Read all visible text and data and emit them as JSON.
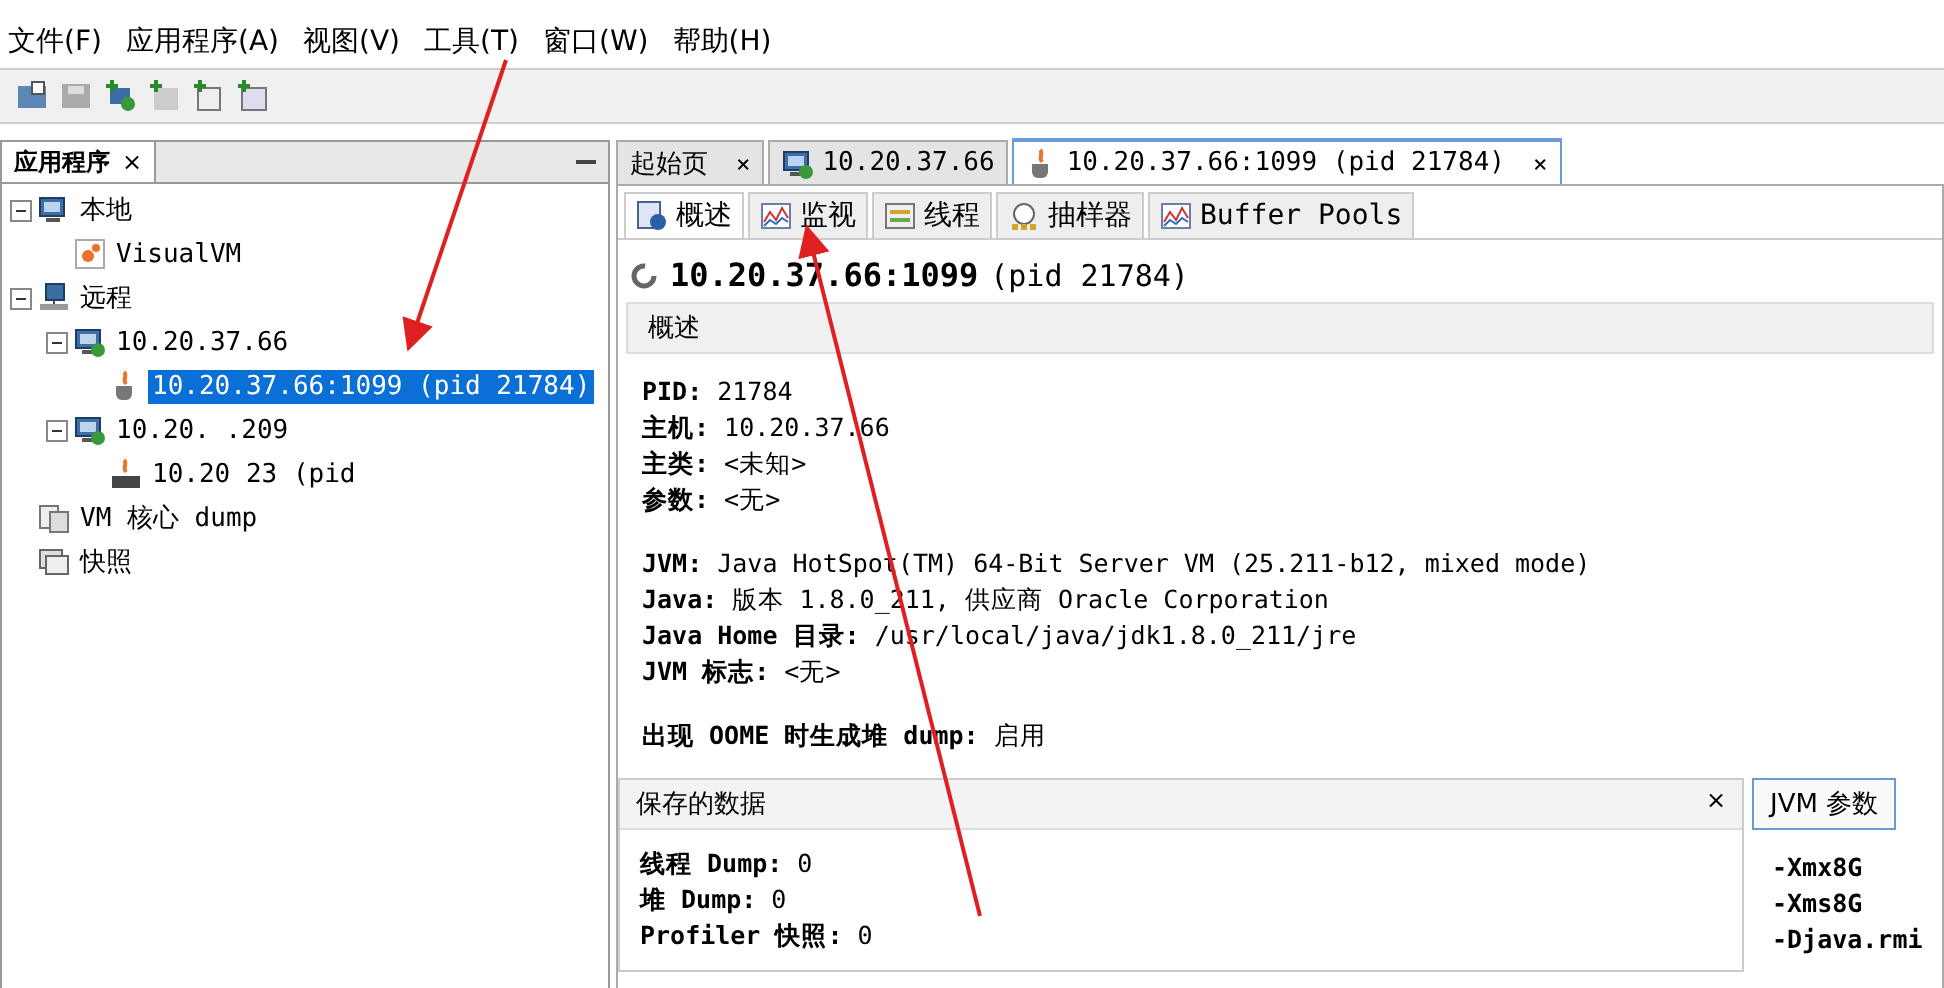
{
  "menu": [
    "文件(F)",
    "应用程序(A)",
    "视图(V)",
    "工具(T)",
    "窗口(W)",
    "帮助(H)"
  ],
  "toolbar": [
    {
      "kind": "open"
    },
    {
      "kind": "save"
    },
    {
      "kind": "add-host"
    },
    {
      "kind": "add-jmx"
    },
    {
      "kind": "add-dump"
    },
    {
      "kind": "add-snapshot"
    }
  ],
  "sidebar": {
    "title": "应用程序",
    "close": "×",
    "tree": [
      {
        "label": "本地",
        "kind": "computer",
        "expanded": true,
        "selected": false,
        "children": [
          {
            "label": "VisualVM",
            "kind": "app",
            "selected": false
          }
        ]
      },
      {
        "label": "远程",
        "kind": "network",
        "expanded": true,
        "selected": false,
        "children": [
          {
            "label": "10.20.37.66",
            "kind": "host",
            "expanded": true,
            "selected": false,
            "children": [
              {
                "label": "10.20.37.66:1099 (pid 21784)",
                "kind": "java",
                "selected": true
              }
            ]
          },
          {
            "label": "10.20.  .209",
            "kind": "host",
            "expanded": true,
            "selected": false,
            "children": [
              {
                "label": "10.20 23 (pid",
                "kind": "jar",
                "selected": false
              }
            ]
          }
        ]
      },
      {
        "label": "VM 核心 dump",
        "kind": "dump",
        "selected": false
      },
      {
        "label": "快照",
        "kind": "snapshot",
        "selected": false
      }
    ]
  },
  "tabs": [
    {
      "label": "起始页",
      "kind": "plain",
      "close": "×",
      "selected": false
    },
    {
      "label": "10.20.37.66",
      "kind": "host",
      "selected": false
    },
    {
      "label": "10.20.37.66:1099 (pid 21784)",
      "kind": "java",
      "close": "×",
      "selected": true
    }
  ],
  "subtabs": [
    {
      "label": "概述",
      "kind": "info",
      "selected": true
    },
    {
      "label": "监视",
      "kind": "chart",
      "selected": false
    },
    {
      "label": "线程",
      "kind": "threads",
      "selected": false
    },
    {
      "label": "抽样器",
      "kind": "sampler",
      "selected": false
    },
    {
      "label": "Buffer Pools",
      "kind": "chart",
      "selected": false
    }
  ],
  "heading": {
    "title": "10.20.37.66:1099",
    "pid": "(pid 21784)"
  },
  "overview": {
    "title": "概述",
    "groups": [
      [
        "**PID:** 21784",
        "**主机:** 10.20.37.66",
        "**主类:** <未知>",
        "**参数:** <无>"
      ],
      [
        "**JVM:** Java HotSpot(TM) 64-Bit Server VM (25.211-b12, mixed mode)",
        "**Java:** 版本 1.8.0_211, 供应商 Oracle Corporation",
        "**Java Home 目录:** /usr/local/java/jdk1.8.0_211/jre",
        "**JVM 标志:** <无>"
      ],
      [
        "**出现 OOME 时生成堆 dump:** 启用"
      ]
    ]
  },
  "saved_data": {
    "title": "保存的数据",
    "close": "×",
    "lines": [
      "**线程 Dump:** 0",
      "**堆 Dump:** 0",
      "**Profiler 快照:** 0"
    ]
  },
  "jvm_panel": {
    "tabs": [
      {
        "label": "JVM 参数",
        "selected": true
      }
    ],
    "lines": [
      "-Xmx8G",
      "-Xms8G",
      "-Djava.rmi"
    ]
  }
}
